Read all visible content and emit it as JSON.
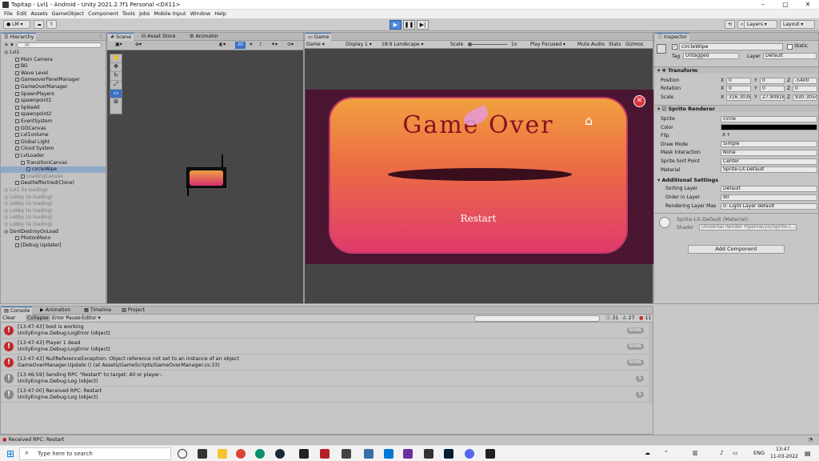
{
  "window": {
    "title": "Tapitap - Lvl1 - Android - Unity 2021.2.7f1 Personal <DX11>"
  },
  "menu": [
    "File",
    "Edit",
    "Assets",
    "GameObject",
    "Component",
    "Tools",
    "Jobs",
    "Mobile Input",
    "Window",
    "Help"
  ],
  "toolbar": {
    "account": "LM",
    "layers": "Layers",
    "layout": "Layout"
  },
  "hierarchy": {
    "tab": "Hierarchy",
    "search_placeholder": "All",
    "items": [
      {
        "label": "Lvl1",
        "indent": 0,
        "type": "scene"
      },
      {
        "label": "Main Camera",
        "indent": 2
      },
      {
        "label": "BG",
        "indent": 2
      },
      {
        "label": "Wave Level",
        "indent": 2
      },
      {
        "label": "GameoverPanelManager",
        "indent": 2
      },
      {
        "label": "GameOverManager",
        "indent": 2
      },
      {
        "label": "SpawnPlayers",
        "indent": 2
      },
      {
        "label": "spawnpoint1",
        "indent": 2
      },
      {
        "label": "SpikeAll",
        "indent": 2
      },
      {
        "label": "spawnpoint2",
        "indent": 2
      },
      {
        "label": "EventSystem",
        "indent": 2
      },
      {
        "label": "GOCanvas",
        "indent": 2
      },
      {
        "label": "Lvl1volume",
        "indent": 2
      },
      {
        "label": "Global Light",
        "indent": 2
      },
      {
        "label": "Cloud System",
        "indent": 2
      },
      {
        "label": "LvlLoader",
        "indent": 2
      },
      {
        "label": "TransitionCanvas",
        "indent": 3
      },
      {
        "label": "circleWipe",
        "indent": 4,
        "selected": true
      },
      {
        "label": "LoadingCanvas",
        "indent": 3,
        "dim": true
      },
      {
        "label": "Deatheffectred(Clone)",
        "indent": 2
      },
      {
        "label": "Lvl1 (is loading)",
        "indent": 0,
        "type": "scene",
        "dim": true
      },
      {
        "label": "Lobby (is loading)",
        "indent": 0,
        "type": "scene",
        "dim": true
      },
      {
        "label": "Lobby (is loading)",
        "indent": 0,
        "type": "scene",
        "dim": true
      },
      {
        "label": "Lobby (is loading)",
        "indent": 0,
        "type": "scene",
        "dim": true
      },
      {
        "label": "Lobby (is loading)",
        "indent": 0,
        "type": "scene",
        "dim": true
      },
      {
        "label": "Lobby (is loading)",
        "indent": 0,
        "type": "scene",
        "dim": true
      },
      {
        "label": "DontDestroyOnLoad",
        "indent": 0,
        "type": "scene"
      },
      {
        "label": "PhotonMono",
        "indent": 2
      },
      {
        "label": "[Debug Updater]",
        "indent": 2
      }
    ]
  },
  "scene_tabs": [
    "Scene",
    "Asset Store",
    "Animator"
  ],
  "game": {
    "tab": "Game",
    "game_label": "Game",
    "display": "Display 1",
    "aspect": "18:9 Landscape",
    "scale_label": "Scale",
    "scale_value": "1x",
    "play_focused": "Play Focused",
    "mute": "Mute Audio",
    "stats": "Stats",
    "gizmos": "Gizmos",
    "title": "Game Over",
    "restart": "Restart"
  },
  "inspector": {
    "tab": "Inspector",
    "name": "circleWipe",
    "static": "Static",
    "tag_label": "Tag",
    "tag": "Untagged",
    "layer_label": "Layer",
    "layer": "Default",
    "transform": {
      "header": "Transform",
      "position_label": "Position",
      "position": {
        "x": "0",
        "y": "0",
        "z": "-5400"
      },
      "rotation_label": "Rotation",
      "rotation": {
        "x": "0",
        "y": "0",
        "z": "0"
      },
      "scale_label": "Scale",
      "scale": {
        "x": "316.3038",
        "y": "27.90916",
        "z": "930.3054"
      }
    },
    "sprite_renderer": {
      "header": "Sprite Renderer",
      "fields": [
        {
          "label": "Sprite",
          "value": "circle"
        },
        {
          "label": "Color",
          "value": ""
        },
        {
          "label": "Flip",
          "value": "X  Y"
        },
        {
          "label": "Draw Mode",
          "value": "Simple"
        },
        {
          "label": "Mask Interaction",
          "value": "None"
        },
        {
          "label": "Sprite Sort Point",
          "value": "Center"
        },
        {
          "label": "Material",
          "value": "Sprite-Lit-Default"
        }
      ],
      "additional_header": "Additional Settings",
      "additional": [
        {
          "label": "Sorting Layer",
          "value": "Default"
        },
        {
          "label": "Order in Layer",
          "value": "90"
        },
        {
          "label": "Rendering Layer Mas",
          "value": "0: Light Layer default"
        }
      ]
    },
    "material": {
      "name": "Sprite-Lit-Default (Material)",
      "shader_label": "Shader",
      "shader": "Universal Render Pipeline/2D/Sprite-L..."
    },
    "add_component": "Add Component"
  },
  "console": {
    "tabs": [
      "Console",
      "Animation",
      "Timeline",
      "Project"
    ],
    "buttons": [
      "Clear",
      "Collapse",
      "Error Pause",
      "Editor"
    ],
    "counts": {
      "info": "31",
      "warn": "27",
      "error": "11"
    },
    "entries": [
      {
        "type": "error",
        "line1": "[13:47:43] bool is working",
        "line2": "UnityEngine.Debug:LogError (object)",
        "count": "6096"
      },
      {
        "type": "error",
        "line1": "[13:47:43] Player 1 dead",
        "line2": "UnityEngine.Debug:LogError (object)",
        "count": "6096"
      },
      {
        "type": "error",
        "line1": "[13:47:43] NullReferenceException: Object reference not set to an instance of an object",
        "line2": "GameOverManager.Update () (at Assets/GameScripts/GameOverManager.cs:33)",
        "count": "6096"
      },
      {
        "type": "info",
        "line1": "[13:46:59] Sending RPC \"Restart\" to target: All or player:.",
        "line2": "UnityEngine.Debug:Log (object)",
        "count": "5"
      },
      {
        "type": "info",
        "line1": "[13:47:00] Received RPC: Restart",
        "line2": "UnityEngine.Debug:Log (object)",
        "count": "5"
      }
    ]
  },
  "status": "Received RPC: Restart",
  "taskbar": {
    "search": "Type here to search",
    "lang": "ENG",
    "time": "13:47",
    "date": "11-03-2022"
  },
  "colors": {
    "accent": "#3a72c4",
    "error": "#c0282c",
    "game_bg": "#4a1530"
  }
}
